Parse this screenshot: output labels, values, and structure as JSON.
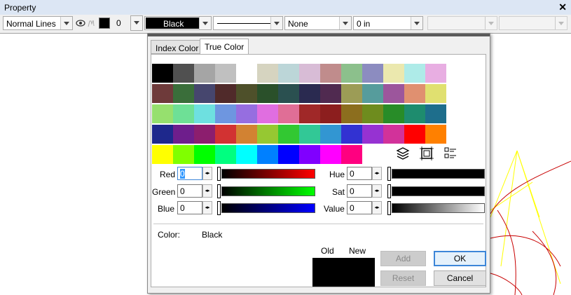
{
  "panel": {
    "title": "Property",
    "close_glyph": "✕",
    "line_type": "Normal Lines",
    "color_index": "0",
    "color_name": "Black",
    "fill": "None",
    "thickness": "0 in"
  },
  "dialog": {
    "tabs": [
      "Index Color",
      "True Color"
    ],
    "active_tab": "True Color",
    "palette": [
      [
        "#000000",
        "#505050",
        "#a5a5a5",
        "#c0c0c0",
        "#ffffff",
        "#d6d4c0",
        "#bcd6d8",
        "#d8bcd6",
        "#c08c8c",
        "#8cc08c",
        "#8c8cc0",
        "#ebe8ae",
        "#aeebe8",
        "#e8aee2"
      ],
      [
        "#6e3a3a",
        "#3a6e3a",
        "#46466e",
        "#502a2a",
        "#4e502a",
        "#2a502a",
        "#2a5050",
        "#2a2a50",
        "#502a50",
        "#9c9c56",
        "#569c9c",
        "#9c569c",
        "#e09070",
        "#e0e070"
      ],
      [
        "#96e06e",
        "#6ee096",
        "#6ee0e0",
        "#6e96e0",
        "#966ee0",
        "#e06ee0",
        "#e06e96",
        "#a02828",
        "#8c1e1e",
        "#8c6e1e",
        "#6e8c1e",
        "#288c28",
        "#1e8c6e",
        "#1e6e8c"
      ],
      [
        "#1e288c",
        "#6e1e8c",
        "#8c1e6e",
        "#d23232",
        "#d28232",
        "#96c832",
        "#32c832",
        "#32c896",
        "#3296d2",
        "#3232d2",
        "#9632d2",
        "#d2329a",
        "#ff0000",
        "#ff8000"
      ],
      [
        "#ffff00",
        "#80ff00",
        "#00ff00",
        "#00ff80",
        "#00ffff",
        "#0080ff",
        "#0000ff",
        "#8000ff",
        "#ff00ff",
        "#ff0080"
      ]
    ],
    "tool_icons": [
      "layers-icon",
      "frame-icon",
      "list-icon"
    ],
    "rgb": {
      "red_label": "Red",
      "green_label": "Green",
      "blue_label": "Blue",
      "red": "0",
      "green": "0",
      "blue": "0"
    },
    "hsv": {
      "hue_label": "Hue",
      "sat_label": "Sat",
      "value_label": "Value",
      "hue": "0",
      "sat": "0",
      "value": "0"
    },
    "color_label": "Color:",
    "color_name": "Black",
    "old_label": "Old",
    "new_label": "New",
    "old_color": "#000000",
    "new_color": "#000000",
    "buttons": {
      "add": "Add",
      "reset": "Reset",
      "ok": "OK",
      "cancel": "Cancel"
    }
  }
}
